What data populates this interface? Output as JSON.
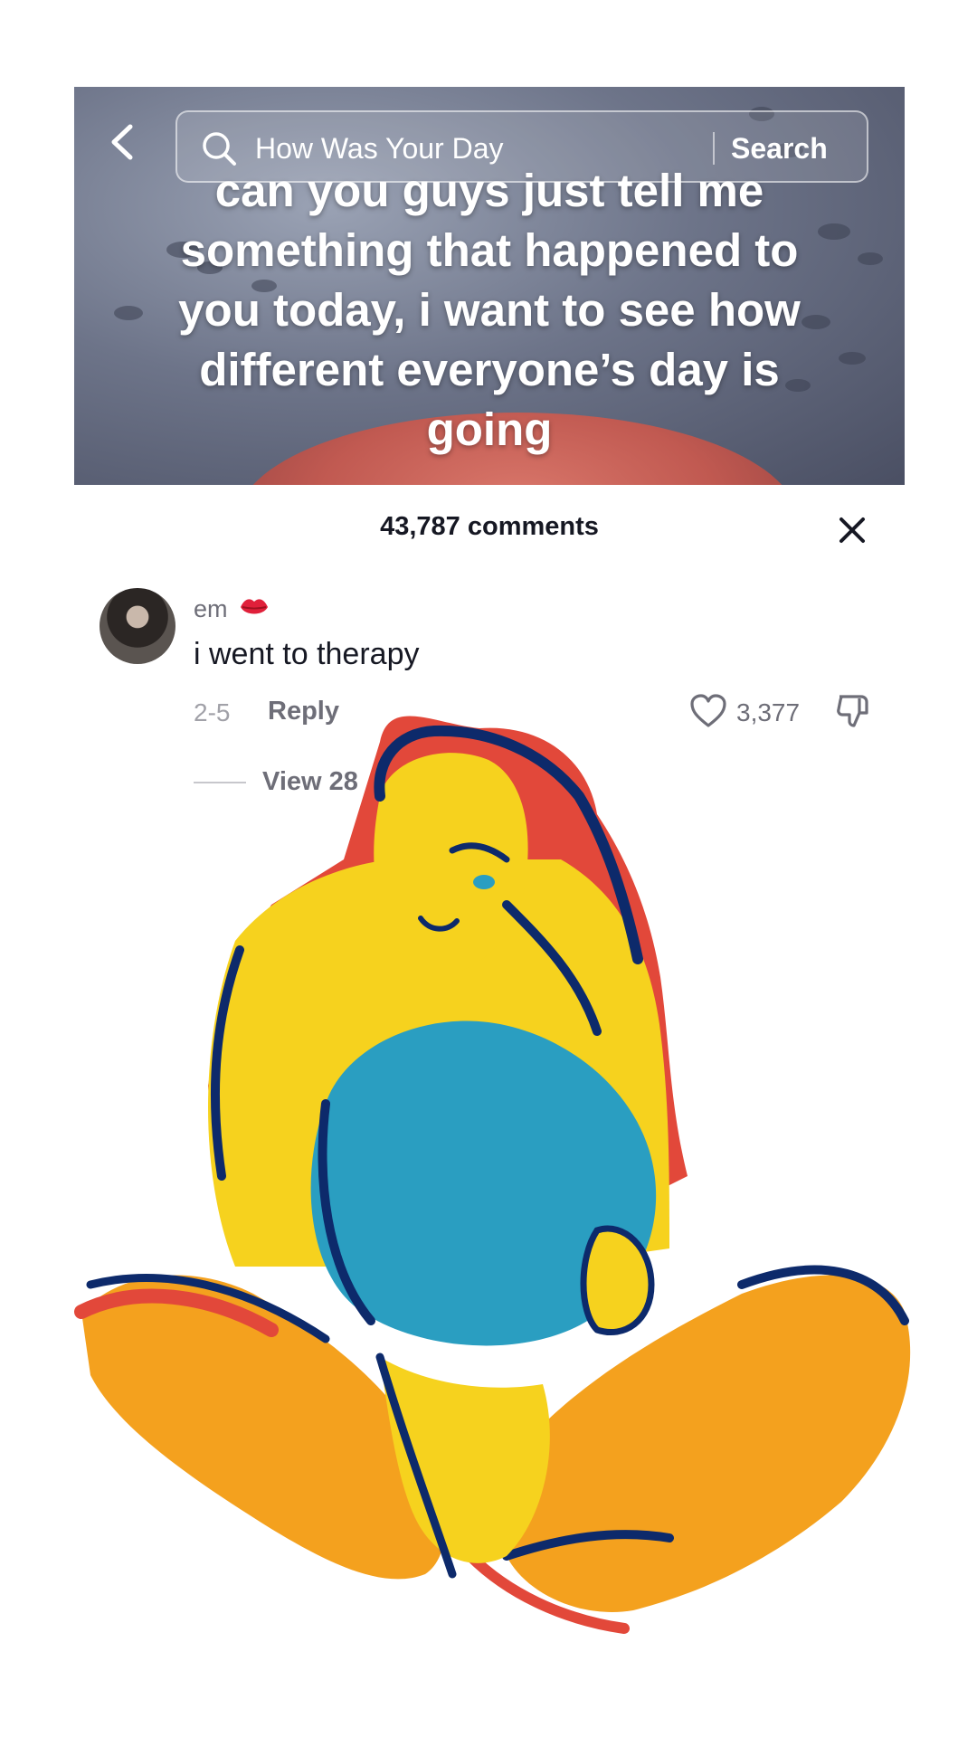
{
  "video": {
    "overlay_text": "can you guys just tell me something that happened to you today, i want to see how different everyone’s day is going"
  },
  "search": {
    "query": "How Was Your Day",
    "button_label": "Search"
  },
  "comments": {
    "count_label": "43,787 comments",
    "items": [
      {
        "username": "em",
        "text": "i went to therapy",
        "date": "2-5",
        "reply_label": "Reply",
        "likes": "3,377",
        "view_replies_label": "View 28"
      }
    ]
  },
  "icons": {
    "back": "chevron-left-icon",
    "search": "search-icon",
    "close": "close-icon",
    "lips": "lips-emoji-icon",
    "heart": "heart-icon",
    "dislike": "thumbs-down-icon"
  },
  "colors": {
    "painting_yellow": "#f6d21e",
    "painting_blue": "#2a9ec1",
    "painting_navy": "#0d2a6b",
    "painting_red": "#e2483a",
    "painting_orange": "#f4a11e"
  }
}
